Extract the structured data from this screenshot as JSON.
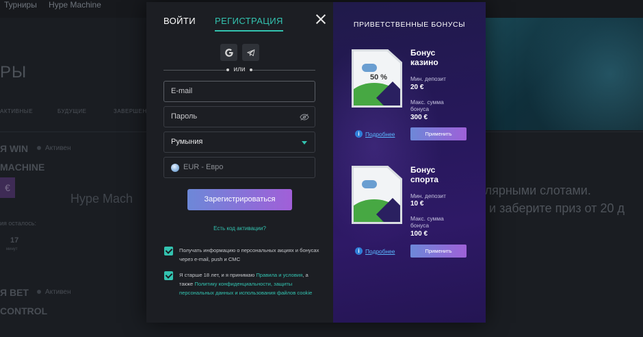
{
  "background": {
    "breadcrumbs": [
      "Турниры",
      "Hype Machine"
    ],
    "page_title": "РЫ",
    "tabs": [
      "АКТИВНЫЕ",
      "БУДУЩИЕ",
      "ЗАВЕРШЕН"
    ],
    "card1": {
      "title": "Я WIN",
      "status": "Активен",
      "name": "MACHINE",
      "badge": "€",
      "img_alt": "Hype Mach",
      "time_left_label": "ия осталось:",
      "time_value": "17",
      "time_unit": "минут"
    },
    "card2": {
      "title": "Я BET",
      "status": "Активен",
      "name": "CONTROL"
    },
    "promo_text_1": "улярными слотами.",
    "promo_text_2": "й и заберите приз от 20 д"
  },
  "modal": {
    "tab_login": "ВОЙТИ",
    "tab_register": "РЕГИСТРАЦИЯ",
    "or_text": "или",
    "email_placeholder": "E-mail",
    "password_placeholder": "Пароль",
    "country_value": "Румыния",
    "currency_value": "EUR - Евро",
    "register_button": "Зарегистрироваться",
    "activation_link": "Есть код активации?",
    "consent_1": "Получать информацию о персональных акциях и бонусах через e-mail, push и СМС",
    "consent_2_prefix": "Я старше 18 лет, и я принимаю ",
    "consent_2_rules": "Правила и условия",
    "consent_2_mid": ", а также ",
    "consent_2_policy": "Политику конфиденциальности, защиты персональных данных и использования файлов cookie"
  },
  "bonuses": {
    "heading": "ПРИВЕТСТВЕННЫЕ БОНУСЫ",
    "items": [
      {
        "title_line1": "Бонус",
        "title_line2": "казино",
        "badge": "50 %",
        "min_label": "Мин. депозит",
        "min_value": "20 €",
        "max_label_1": "Макс. сумма",
        "max_label_2": "бонуса",
        "max_value": "300 €",
        "more": "Подробнее",
        "apply": "Применить"
      },
      {
        "title_line1": "Бонус",
        "title_line2": "спорта",
        "badge": "",
        "min_label": "Мин. депозит",
        "min_value": "10 €",
        "max_label_1": "Макс. сумма",
        "max_label_2": "бонуса",
        "max_value": "100 €",
        "more": "Подробнее",
        "apply": "Применить"
      }
    ]
  },
  "colors": {
    "accent": "#33c3b0",
    "button_gradient_start": "#6d88d8",
    "button_gradient_end": "#a15fd8",
    "panel": "#1c1e23",
    "bonus_panel": "#26185a"
  },
  "icons": [
    "close-icon",
    "google-icon",
    "telegram-icon",
    "eye-off-icon",
    "chevron-down-icon",
    "globe-icon",
    "check-icon",
    "info-icon"
  ]
}
